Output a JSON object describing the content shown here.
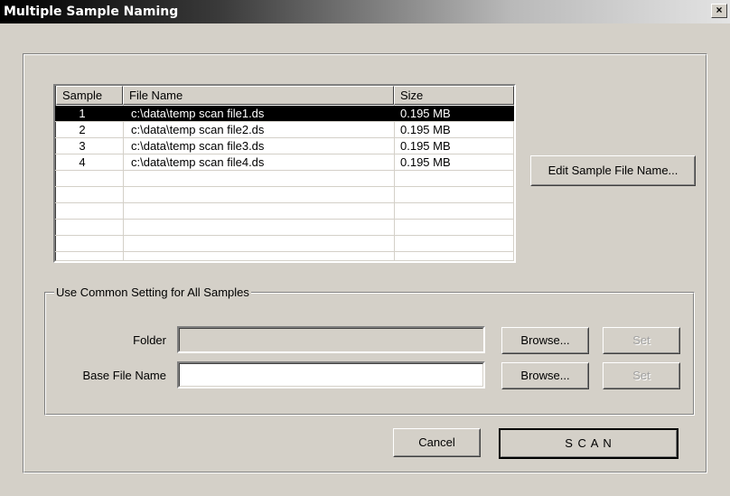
{
  "window": {
    "title": "Multiple Sample Naming",
    "close_glyph": "×"
  },
  "table": {
    "headers": {
      "sample": "Sample",
      "file_name": "File Name",
      "size": "Size"
    },
    "rows": [
      {
        "sample": "1",
        "file_name": "c:\\data\\temp scan file1.ds",
        "size": "0.195 MB"
      },
      {
        "sample": "2",
        "file_name": "c:\\data\\temp scan file2.ds",
        "size": "0.195 MB"
      },
      {
        "sample": "3",
        "file_name": "c:\\data\\temp scan file3.ds",
        "size": "0.195 MB"
      },
      {
        "sample": "4",
        "file_name": "c:\\data\\temp scan file4.ds",
        "size": "0.195 MB"
      }
    ]
  },
  "edit_button": {
    "label": "Edit Sample File Name..."
  },
  "common": {
    "legend": "Use Common Setting for All Samples",
    "folder_label": "Folder",
    "folder_value": "",
    "base_label": "Base File Name",
    "base_value": "",
    "browse_label": "Browse...",
    "set_label": "Set"
  },
  "footer": {
    "cancel_label": "Cancel",
    "scan_label": "S C A N"
  }
}
